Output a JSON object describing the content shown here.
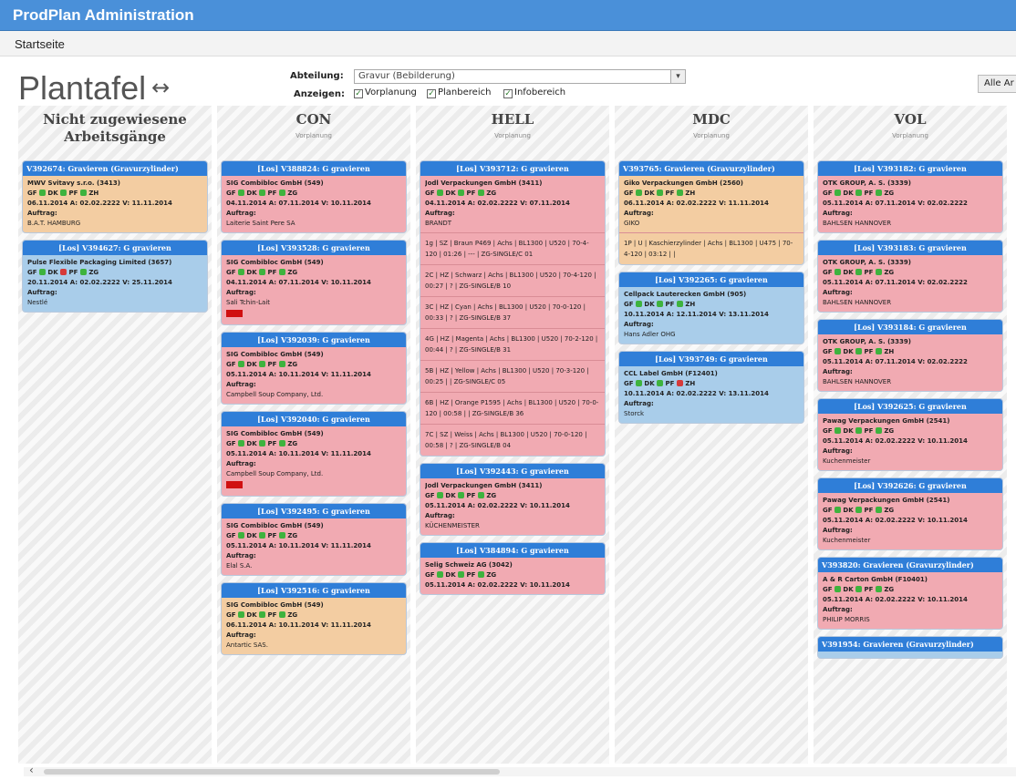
{
  "app": {
    "title": "ProdPlan Administration"
  },
  "nav": {
    "home": "Startseite"
  },
  "page": {
    "title": "Plantafel",
    "arrow": "↔",
    "all_button": "Alle Ar"
  },
  "filters": {
    "abteilung_label": "Abteilung:",
    "abteilung_value": "Gravur (Bebilderung)",
    "anzeigen_label": "Anzeigen:",
    "checks": [
      {
        "label": "Vorplanung",
        "checked": true
      },
      {
        "label": "Planbereich",
        "checked": true
      },
      {
        "label": "Infobereich",
        "checked": true
      }
    ]
  },
  "columns": [
    {
      "name": "Nicht zugewiesene Arbeitsgänge",
      "sub": "",
      "cards": [
        {
          "color": "tan",
          "head": "V392674: Gravieren (Gravurzylinder)",
          "center": false,
          "company": "MWV Svitavy s.r.o. (3413)",
          "status": [
            "GF",
            "DK",
            "PF",
            "ZH"
          ],
          "dates": "06.11.2014 A: 02.02.2222 V: 11.11.2014",
          "auftrag": "Auftrag:",
          "value": "B.A.T. HAMBURG"
        },
        {
          "color": "blue",
          "head": "[Los] V394627: G gravieren",
          "center": true,
          "company": "Pulse Flexible Packaging Limited (3657)",
          "status": [
            "GF",
            "DK",
            "PF",
            "ZG"
          ],
          "red": [
            1
          ],
          "dates": "20.11.2014 A: 02.02.2222 V: 25.11.2014",
          "auftrag": "Auftrag:",
          "value": "Nestlé"
        }
      ]
    },
    {
      "name": "CON",
      "sub": "Vorplanung",
      "cards": [
        {
          "color": "pink",
          "head": "[Los] V388824: G gravieren",
          "center": true,
          "company": "SIG Combibloc GmbH (549)",
          "status": [
            "GF",
            "DK",
            "PF",
            "ZG"
          ],
          "dates": "04.11.2014 A: 07.11.2014 V: 10.11.2014",
          "auftrag": "Auftrag:",
          "value": "Laiterie Saint Pere SA"
        },
        {
          "color": "pink",
          "head": "[Los] V393528: G gravieren",
          "center": true,
          "company": "SIG Combibloc GmbH (549)",
          "status": [
            "GF",
            "DK",
            "PF",
            "ZG"
          ],
          "dates": "04.11.2014 A: 07.11.2014 V: 10.11.2014",
          "auftrag": "Auftrag:",
          "value": "Sali Tchin-Lait",
          "redtag": true
        },
        {
          "color": "pink",
          "head": "[Los] V392039: G gravieren",
          "center": true,
          "company": "SIG Combibloc GmbH (549)",
          "status": [
            "GF",
            "DK",
            "PF",
            "ZG"
          ],
          "dates": "05.11.2014 A: 10.11.2014 V: 11.11.2014",
          "auftrag": "Auftrag:",
          "value": "Campbell Soup Company, Ltd."
        },
        {
          "color": "pink",
          "head": "[Los] V392040: G gravieren",
          "center": true,
          "company": "SIG Combibloc GmbH (549)",
          "status": [
            "GF",
            "DK",
            "PF",
            "ZG"
          ],
          "dates": "05.11.2014 A: 10.11.2014 V: 11.11.2014",
          "auftrag": "Auftrag:",
          "value": "Campbell Soup Company, Ltd.",
          "redtag": true
        },
        {
          "color": "pink",
          "head": "[Los] V392495: G gravieren",
          "center": true,
          "company": "SIG Combibloc GmbH (549)",
          "status": [
            "GF",
            "DK",
            "PF",
            "ZG"
          ],
          "dates": "05.11.2014 A: 10.11.2014 V: 11.11.2014",
          "auftrag": "Auftrag:",
          "value": "Elal S.A."
        },
        {
          "color": "tan",
          "head": "[Los] V392516: G gravieren",
          "center": true,
          "company": "SIG Combibloc GmbH (549)",
          "status": [
            "GF",
            "DK",
            "PF",
            "ZG"
          ],
          "dates": "06.11.2014 A: 10.11.2014 V: 11.11.2014",
          "auftrag": "Auftrag:",
          "value": "Antartic SAS."
        }
      ]
    },
    {
      "name": "HELL",
      "sub": "Vorplanung",
      "cards": [
        {
          "color": "pink",
          "head": "[Los] V393712: G gravieren",
          "center": true,
          "company": "Jodl Verpackungen GmbH (3411)",
          "status": [
            "GF",
            "DK",
            "PF",
            "ZG"
          ],
          "dates": "04.11.2014 A: 02.02.2222 V: 07.11.2014",
          "auftrag": "Auftrag:",
          "value": "BRANDT",
          "ops": [
            "1g | SZ | Braun P469 | Achs | BL1300 | U520 | 70-4-120 | 01:26 | --- | ZG-SINGLE/C 01",
            "2C | HZ | Schwarz | Achs | BL1300 | U520 | 70-4-120 | 00:27 | ? | ZG-SINGLE/B 10",
            "3C | HZ | Cyan | Achs | BL1300 | U520 | 70-0-120 | 00:33 | ? | ZG-SINGLE/B 37",
            "4G | HZ | Magenta | Achs | BL1300 | U520 | 70-2-120 | 00:44 | ? | ZG-SINGLE/B 31",
            "5B | HZ | Yellow | Achs | BL1300 | U520 | 70-3-120 | 00:25 | | ZG-SINGLE/C 05",
            "6B | HZ | Orange P1595 | Achs | BL1300 | U520 | 70-0-120 | 00:58 | | ZG-SINGLE/B 36",
            "7C | SZ | Weiss | Achs | BL1300 | U520 | 70-0-120 | 00:58 | ? | ZG-SINGLE/B 04"
          ]
        },
        {
          "color": "pink",
          "head": "[Los] V392443: G gravieren",
          "center": true,
          "company": "Jodl Verpackungen GmbH (3411)",
          "status": [
            "GF",
            "DK",
            "PF",
            "ZG"
          ],
          "dates": "05.11.2014 A: 02.02.2222 V: 10.11.2014",
          "auftrag": "Auftrag:",
          "value": "KÜCHENMEISTER"
        },
        {
          "color": "pink",
          "head": "[Los] V384894: G gravieren",
          "center": true,
          "company": "Selig Schweiz AG (3042)",
          "status": [
            "GF",
            "DK",
            "PF",
            "ZG"
          ],
          "dates": "05.11.2014 A: 02.02.2222 V: 10.11.2014",
          "auftrag": "",
          "value": ""
        }
      ]
    },
    {
      "name": "MDC",
      "sub": "Vorplanung",
      "cards": [
        {
          "color": "tan",
          "head": "V393765: Gravieren (Gravurzylinder)",
          "center": false,
          "company": "Giko Verpackungen GmbH (2560)",
          "status": [
            "GF",
            "DK",
            "PF",
            "ZH"
          ],
          "dates": "06.11.2014 A: 02.02.2222 V: 11.11.2014",
          "auftrag": "Auftrag:",
          "value": "GIKO",
          "ops": [
            "1P | U | Kaschierzylinder | Achs | BL1300 | U475 | 70-4-120 | 03:12 | |"
          ]
        },
        {
          "color": "blue",
          "head": "[Los] V392265: G gravieren",
          "center": true,
          "company": "Cellpack Lauterecken GmbH (905)",
          "status": [
            "GF",
            "DK",
            "PF",
            "ZH"
          ],
          "dates": "10.11.2014 A: 12.11.2014 V: 13.11.2014",
          "auftrag": "Auftrag:",
          "value": "Hans Adler OHG"
        },
        {
          "color": "blue",
          "head": "[Los] V393749: G gravieren",
          "center": true,
          "company": "CCL Label GmbH (F12401)",
          "status": [
            "GF",
            "DK",
            "PF",
            "ZH"
          ],
          "red": [
            2
          ],
          "dates": "10.11.2014 A: 02.02.2222 V: 13.11.2014",
          "auftrag": "Auftrag:",
          "value": "Storck"
        }
      ]
    },
    {
      "name": "VOL",
      "sub": "Vorplanung",
      "cards": [
        {
          "color": "pink",
          "head": "[Los] V393182: G gravieren",
          "center": true,
          "company": "OTK GROUP, A. S. (3339)",
          "status": [
            "GF",
            "DK",
            "PF",
            "ZG"
          ],
          "dates": "05.11.2014 A: 07.11.2014 V: 02.02.2222",
          "auftrag": "Auftrag:",
          "value": "BAHLSEN HANNOVER"
        },
        {
          "color": "pink",
          "head": "[Los] V393183: G gravieren",
          "center": true,
          "company": "OTK GROUP, A. S. (3339)",
          "status": [
            "GF",
            "DK",
            "PF",
            "ZG"
          ],
          "dates": "05.11.2014 A: 07.11.2014 V: 02.02.2222",
          "auftrag": "Auftrag:",
          "value": "BAHLSEN HANNOVER"
        },
        {
          "color": "pink",
          "head": "[Los] V393184: G gravieren",
          "center": true,
          "company": "OTK GROUP, A. S. (3339)",
          "status": [
            "GF",
            "DK",
            "PF",
            "ZH"
          ],
          "dates": "05.11.2014 A: 07.11.2014 V: 02.02.2222",
          "auftrag": "Auftrag:",
          "value": "BAHLSEN HANNOVER"
        },
        {
          "color": "pink",
          "head": "[Los] V392625: G gravieren",
          "center": true,
          "company": "Pawag Verpackungen GmbH (2541)",
          "status": [
            "GF",
            "DK",
            "PF",
            "ZG"
          ],
          "dates": "05.11.2014 A: 02.02.2222 V: 10.11.2014",
          "auftrag": "Auftrag:",
          "value": "Kuchenmeister"
        },
        {
          "color": "pink",
          "head": "[Los] V392626: G gravieren",
          "center": true,
          "company": "Pawag Verpackungen GmbH (2541)",
          "status": [
            "GF",
            "DK",
            "PF",
            "ZG"
          ],
          "dates": "05.11.2014 A: 02.02.2222 V: 10.11.2014",
          "auftrag": "Auftrag:",
          "value": "Kuchenmeister"
        },
        {
          "color": "pink",
          "head": "V393820: Gravieren (Gravurzylinder)",
          "center": false,
          "company": "A & R Carton GmbH (F10401)",
          "status": [
            "GF",
            "DK",
            "PF",
            "ZG"
          ],
          "dates": "05.11.2014 A: 02.02.2222 V: 10.11.2014",
          "auftrag": "Auftrag:",
          "value": "PHILIP MORRIS"
        },
        {
          "color": "blue",
          "head": "V391954: Gravieren (Gravurzylinder)",
          "center": false,
          "company": "",
          "status": [],
          "dates": "",
          "auftrag": "",
          "value": ""
        }
      ]
    }
  ]
}
